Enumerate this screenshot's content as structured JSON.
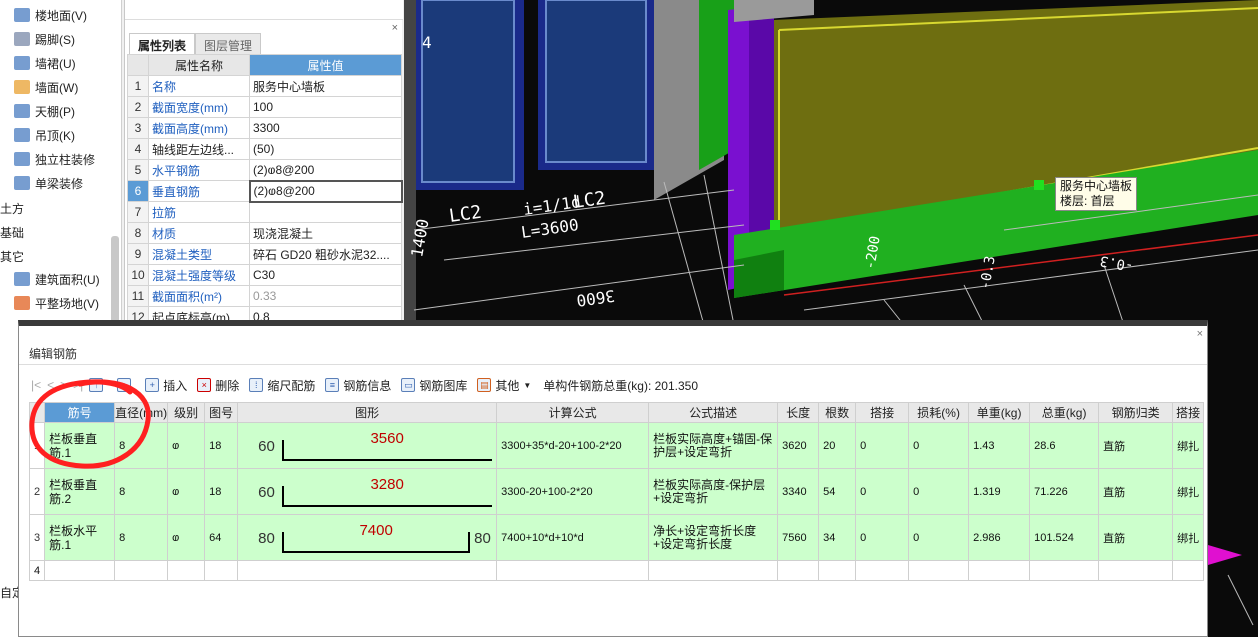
{
  "nav": {
    "items": [
      {
        "label": "楼地面(V)",
        "icon": "floor-icon",
        "color": "#4a7cc0"
      },
      {
        "label": "踢脚(S)",
        "icon": "skirting-icon",
        "color": "#7a8aa8"
      },
      {
        "label": "墙裙(U)",
        "icon": "dado-icon",
        "color": "#4a7cc0"
      },
      {
        "label": "墙面(W)",
        "icon": "wall-surface-icon",
        "color": "#e8a030"
      },
      {
        "label": "天棚(P)",
        "icon": "ceiling-icon",
        "color": "#4a7cc0"
      },
      {
        "label": "吊顶(K)",
        "icon": "suspended-ceiling-icon",
        "color": "#4a7cc0"
      },
      {
        "label": "独立柱装修",
        "icon": "column-finish-icon",
        "color": "#4a7cc0"
      },
      {
        "label": "单梁装修",
        "icon": "beam-finish-icon",
        "color": "#4a7cc0"
      }
    ],
    "sections": [
      "土方",
      "基础",
      "其它"
    ],
    "other_items": [
      {
        "label": "建筑面积(U)",
        "icon": "building-area-icon",
        "color": "#4a7cc0"
      },
      {
        "label": "平整场地(V)",
        "icon": "site-leveling-icon",
        "color": "#e06020"
      }
    ],
    "bottom_label": "自定"
  },
  "props": {
    "close": "×",
    "tabs": [
      "属性列表",
      "图层管理"
    ],
    "headers": {
      "name": "属性名称",
      "value": "属性值"
    },
    "rows": [
      {
        "n": "1",
        "name": "名称",
        "value": "服务中心墙板",
        "blue": true
      },
      {
        "n": "2",
        "name": "截面宽度(mm)",
        "value": "100",
        "blue": true
      },
      {
        "n": "3",
        "name": "截面高度(mm)",
        "value": "3300",
        "blue": true
      },
      {
        "n": "4",
        "name": "轴线距左边线...",
        "value": "(50)",
        "blue": false
      },
      {
        "n": "5",
        "name": "水平钢筋",
        "value": "(2)ⱷ8@200",
        "blue": true
      },
      {
        "n": "6",
        "name": "垂直钢筋",
        "value": "(2)ⱷ8@200",
        "blue": true
      },
      {
        "n": "7",
        "name": "拉筋",
        "value": "",
        "blue": true
      },
      {
        "n": "8",
        "name": "材质",
        "value": "现浇混凝土",
        "blue": true
      },
      {
        "n": "9",
        "name": "混凝土类型",
        "value": "碎石 GD20 粗砂水泥32....",
        "blue": true
      },
      {
        "n": "10",
        "name": "混凝土强度等级",
        "value": "C30",
        "blue": true
      },
      {
        "n": "11",
        "name": "截面面积(m²)",
        "value": "0.33",
        "blue": true
      },
      {
        "n": "12",
        "name": "起点底标高(m)",
        "value": "0.8",
        "blue": false
      }
    ]
  },
  "viewport": {
    "tooltip_line1": "服务中心墙板",
    "tooltip_line2": "楼层: 首层",
    "labels": {
      "four": "4",
      "lc2_a": "LC2",
      "lc2_b": "LC2",
      "slope": "i=1/1d",
      "length": "L=3600",
      "dim1": "1400",
      "dim2": "3600",
      "dim3": "-200",
      "dim4": "-0.3",
      "dim5": "-0.3"
    }
  },
  "rebar": {
    "title": "编辑钢筋",
    "close": "×",
    "toolbar": {
      "nav_first": "|<",
      "nav_prev": "<",
      "nav_next": ">",
      "nav_last": ">|",
      "insert": "插入",
      "delete": "删除",
      "scale": "缩尺配筋",
      "info": "钢筋信息",
      "library": "钢筋图库",
      "other": "其他",
      "total_label": "单构件钢筋总重(kg): 201.350"
    },
    "columns": [
      "筋号",
      "直径(mm)",
      "级别",
      "图号",
      "图形",
      "计算公式",
      "公式描述",
      "长度",
      "根数",
      "搭接",
      "损耗(%)",
      "单重(kg)",
      "总重(kg)",
      "钢筋归类",
      "搭接"
    ],
    "rows": [
      {
        "idx": "1",
        "name": "栏板垂直筋.1",
        "dia": "8",
        "grade": "ⱷ",
        "fig": "18",
        "left": "60",
        "mid": "3560",
        "right": "",
        "formula": "3300+35*d-20+100-2*20",
        "desc": "栏板实际高度+锚固-保护层+设定弯折",
        "len": "3620",
        "count": "20",
        "lap": "0",
        "loss": "0",
        "unit": "1.43",
        "total": "28.6",
        "cat": "直筋",
        "laptype": "绑扎"
      },
      {
        "idx": "2",
        "name": "栏板垂直筋.2",
        "dia": "8",
        "grade": "ⱷ",
        "fig": "18",
        "left": "60",
        "mid": "3280",
        "right": "",
        "formula": "3300-20+100-2*20",
        "desc": "栏板实际高度-保护层+设定弯折",
        "len": "3340",
        "count": "54",
        "lap": "0",
        "loss": "0",
        "unit": "1.319",
        "total": "71.226",
        "cat": "直筋",
        "laptype": "绑扎"
      },
      {
        "idx": "3",
        "name": "栏板水平筋.1",
        "dia": "8",
        "grade": "ⱷ",
        "fig": "64",
        "left": "80",
        "mid": "7400",
        "right": "80",
        "formula": "7400+10*d+10*d",
        "desc": "净长+设定弯折长度+设定弯折长度",
        "len": "7560",
        "count": "34",
        "lap": "0",
        "loss": "0",
        "unit": "2.986",
        "total": "101.524",
        "cat": "直筋",
        "laptype": "绑扎"
      }
    ],
    "empty_idx": "4"
  }
}
